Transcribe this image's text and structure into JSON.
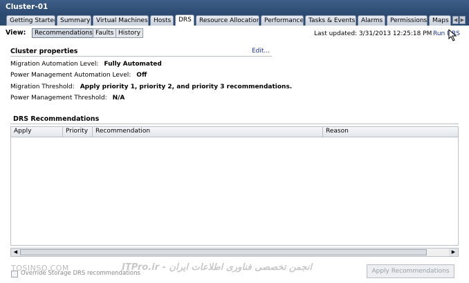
{
  "window": {
    "title": "Cluster-01"
  },
  "tabs": [
    {
      "label": "Getting Started"
    },
    {
      "label": "Summary"
    },
    {
      "label": "Virtual Machines"
    },
    {
      "label": "Hosts"
    },
    {
      "label": "DRS"
    },
    {
      "label": "Resource Allocation"
    },
    {
      "label": "Performance"
    },
    {
      "label": "Tasks & Events"
    },
    {
      "label": "Alarms"
    },
    {
      "label": "Permissions"
    },
    {
      "label": "Maps"
    }
  ],
  "active_tab": "DRS",
  "viewbar": {
    "view_label": "View:",
    "buttons": [
      {
        "label": "Recommendations"
      },
      {
        "label": "Faults"
      },
      {
        "label": "History"
      }
    ],
    "selected": "Recommendations",
    "last_updated": "Last updated: 3/31/2013 12:25:18 PM",
    "run_drs": "Run DRS"
  },
  "cluster_properties": {
    "title": "Cluster properties",
    "edit_label": "Edit...",
    "rows": [
      {
        "label": "Migration Automation Level:",
        "value": "Fully Automated"
      },
      {
        "label": "Power Management Automation Level:",
        "value": "Off"
      },
      {
        "label": "Migration Threshold:",
        "value": "Apply priority 1, priority 2, and priority 3 recommendations."
      },
      {
        "label": "Power Management Threshold:",
        "value": "N/A"
      }
    ]
  },
  "drs_recommendations": {
    "title": "DRS Recommendations",
    "columns": [
      "Apply",
      "Priority",
      "Recommendation",
      "Reason"
    ]
  },
  "footer": {
    "override_label": "Override Storage DRS recommendations",
    "apply_button": "Apply Recommendations",
    "watermark_left": "TOSINSO.COM",
    "watermark_right": "ITPro.ir - انجمن تخصصی فناوری اطلاعات ایران"
  }
}
